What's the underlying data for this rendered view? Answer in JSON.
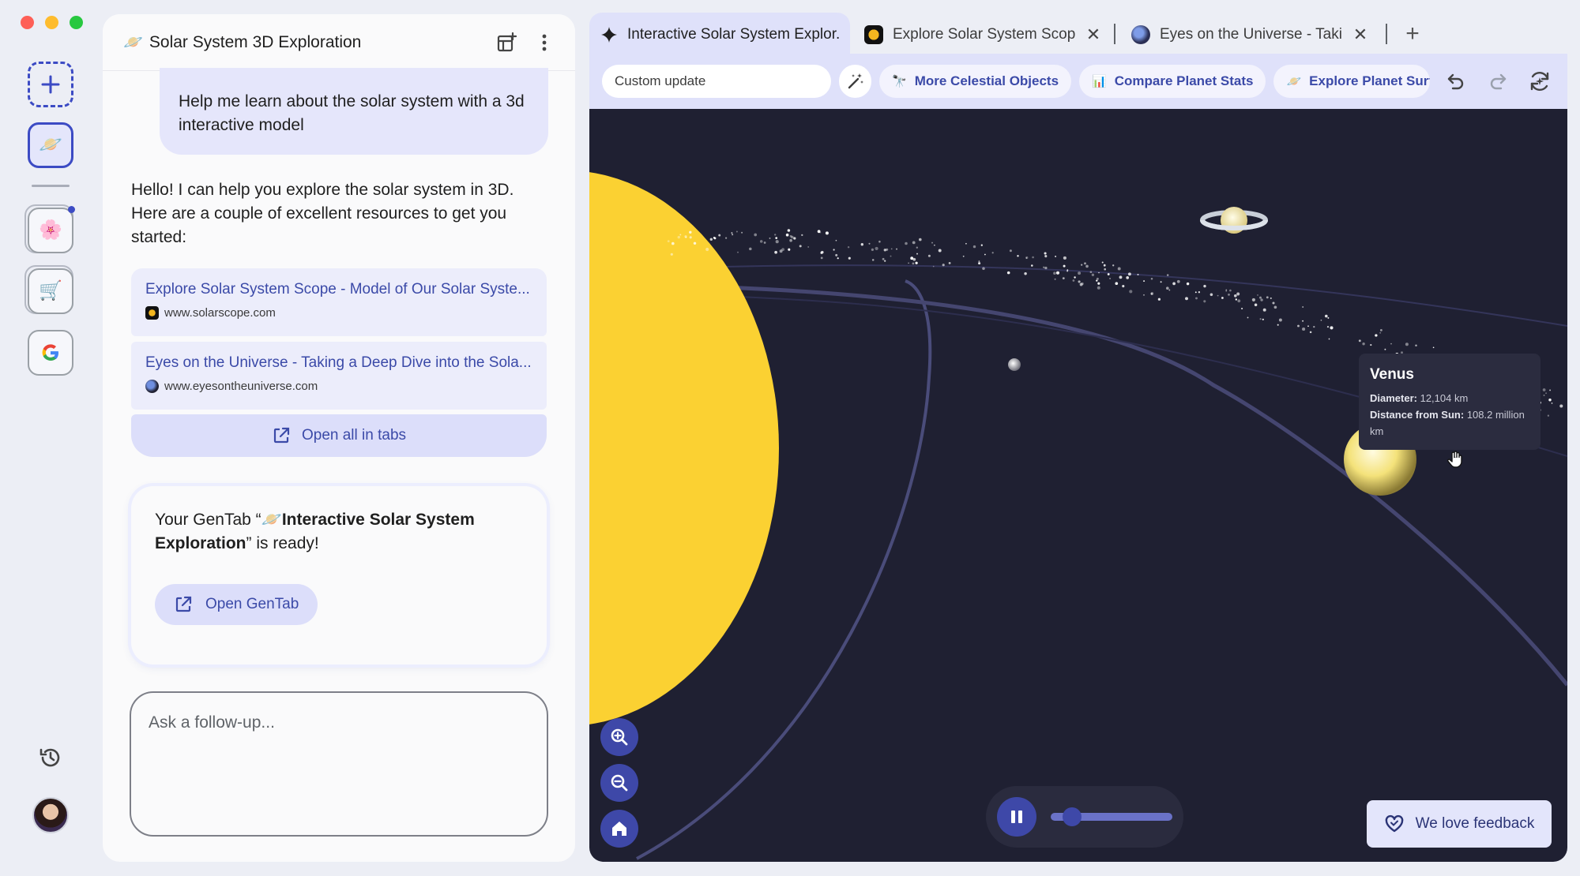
{
  "chat": {
    "title": "Solar System 3D Exploration",
    "title_emoji": "🪐",
    "user_message": "Help me learn about the solar system with a 3d interactive model",
    "assistant_reply": "Hello! I can help you explore the solar system in 3D. Here are a couple of excellent resources to get you started:",
    "links": [
      {
        "title": "Explore Solar System Scope - Model of Our Solar Syste...",
        "url": "www.solarscope.com",
        "icon": "solar-scope-favicon"
      },
      {
        "title": "Eyes on the Universe - Taking a Deep Dive into the Sola...",
        "url": "www.eyesontheuniverse.com",
        "icon": "eyes-universe-favicon"
      }
    ],
    "open_all_label": "Open all in tabs",
    "gentab": {
      "prefix": "Your GenTab “",
      "emoji": "🪐",
      "name": "Interactive Solar System Exploration",
      "suffix": "” is ready!",
      "button_label": "Open GenTab"
    },
    "followup_placeholder": "Ask a follow-up..."
  },
  "rail": {
    "items": [
      "new-chat",
      "saturn-chat",
      "flower-chat",
      "cart-chat",
      "google-chat"
    ],
    "saturn_emoji": "🪐",
    "flower_emoji": "🌸",
    "cart_emoji": "🛒"
  },
  "tabs": [
    {
      "label": "Interactive Solar System Explor...",
      "active": true,
      "icon": "sparkle-icon"
    },
    {
      "label": "Explore Solar System Scope - ",
      "active": false,
      "icon": "solar-scope-favicon"
    },
    {
      "label": "Eyes on the Universe - Taking",
      "active": false,
      "icon": "eyes-universe-favicon"
    }
  ],
  "toolbar": {
    "custom_update_placeholder": "Custom update",
    "chips": [
      {
        "label": "More Celestial Objects",
        "icon": "telescope-icon",
        "emoji": "🔭"
      },
      {
        "label": "Compare Planet Stats",
        "icon": "bar-chart-icon",
        "emoji": "📊"
      },
      {
        "label": "Explore Planet Surface",
        "icon": "saturn-icon",
        "emoji": "🪐"
      }
    ]
  },
  "scene": {
    "tooltip": {
      "title": "Venus",
      "diameter_label": "Diameter:",
      "diameter_value": "12,104 km",
      "distance_label": "Distance from Sun:",
      "distance_value": "108.2 million km"
    },
    "speed_level": 0.12,
    "feedback_label": "We love feedback",
    "colors": {
      "sun": "#fbd132",
      "space": "#1f2032",
      "accent": "#3e48a8"
    }
  }
}
